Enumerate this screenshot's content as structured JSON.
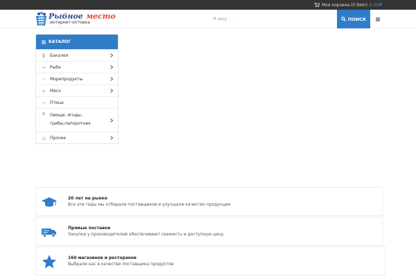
{
  "header": {
    "cart_label": "Моя корзина (0 item)",
    "cart_total": "0.00₽",
    "logo_title_part1": "Рыбное ",
    "logo_title_part2": "место",
    "logo_subtitle": "интернет-оптовка",
    "search_placeholder": "Я ищу ...",
    "search_button": "ПОИСК"
  },
  "catalog": {
    "title": "КАТАЛОГ",
    "items": [
      {
        "label": "Бакалея",
        "icon": "grocery-icon",
        "arrow": true
      },
      {
        "label": "Рыба",
        "icon": "fish-icon",
        "arrow": true
      },
      {
        "label": "Морепродукты",
        "icon": "seafood-icon",
        "arrow": true
      },
      {
        "label": "Мясо",
        "icon": "meat-icon",
        "arrow": true
      },
      {
        "label": "Птица",
        "icon": "poultry-icon",
        "arrow": false
      },
      {
        "label": "Овощи, ягоды, грибы,папоротник",
        "line1": "Овощи, ягоды,",
        "line2": "грибы,папоротник",
        "icon": "vegetables-icon",
        "arrow": true
      },
      {
        "label": "Прочее",
        "icon": "other-icon",
        "arrow": true
      }
    ]
  },
  "features": [
    {
      "title": "20 лет на рынке",
      "description": "Все эти годы мы отбирали поставщиков и улучшали качество продукции",
      "icon": "graduation-cap-icon"
    },
    {
      "title": "Прямые поставки",
      "description": "Закупки у производителей обеспечивают свежесть и доступную цену",
      "icon": "delivery-truck-icon"
    },
    {
      "title": "160 магазинов и ресторанов",
      "description": "Выбрали нас в качестве поставщика продуктов",
      "icon": "star-icon"
    }
  ],
  "colors": {
    "accent": "#2f7dc9",
    "topbar": "#333333",
    "logo_red": "#e8473c",
    "logo_blue": "#2f4f8f",
    "cart_sum": "#4a90e2"
  }
}
